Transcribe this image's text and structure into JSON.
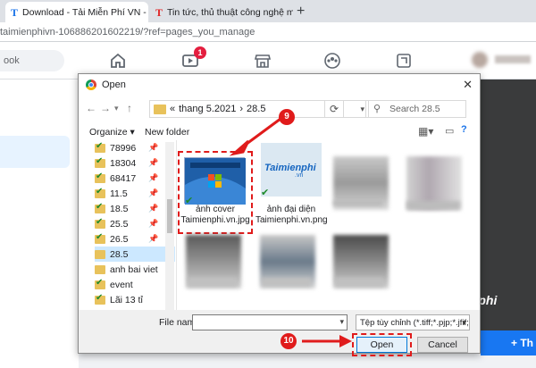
{
  "browser": {
    "tabs": [
      {
        "label": "Download - Tải Miễn Phí VN - Ph",
        "favicon": "T",
        "active": true
      },
      {
        "label": "Tin tức, thủ thuật công nghệ mới",
        "favicon": "T",
        "active": false
      }
    ],
    "close_glyph": "×",
    "new_tab_glyph": "+",
    "url": "taimienphivn-106886201602219/?ref=pages_you_manage"
  },
  "facebook": {
    "search_text": "ook",
    "notification_count": "1",
    "right_button_label": "+ Th",
    "icons": [
      "home-icon",
      "video-icon",
      "marketplace-icon",
      "groups-icon",
      "gaming-icon"
    ]
  },
  "dialog": {
    "title": "Open",
    "close_glyph": "✕",
    "path": {
      "prefix": "«",
      "parts": [
        "thang 5.2021",
        "28.5"
      ],
      "separator": "›"
    },
    "search_placeholder": "Search 28.5",
    "toolbar": {
      "organize": "Organize ▾",
      "new_folder": "New folder"
    },
    "nav_items": [
      {
        "label": "78996",
        "pinned": true,
        "selected": false
      },
      {
        "label": "18304",
        "pinned": true,
        "selected": false
      },
      {
        "label": "68417",
        "pinned": true,
        "selected": false
      },
      {
        "label": "11.5",
        "pinned": true,
        "selected": false
      },
      {
        "label": "18.5",
        "pinned": true,
        "selected": false
      },
      {
        "label": "25.5",
        "pinned": true,
        "selected": false
      },
      {
        "label": "26.5",
        "pinned": true,
        "selected": false
      },
      {
        "label": "28.5",
        "pinned": false,
        "selected": true
      },
      {
        "label": "anh bai viet",
        "pinned": false,
        "selected": false
      },
      {
        "label": "event",
        "pinned": false,
        "selected": false
      },
      {
        "label": "Lãi 13 tỉ",
        "pinned": false,
        "selected": false
      }
    ],
    "files": [
      {
        "caption": "ảnh cover Taimienphi.vn.jpg",
        "selected": true
      },
      {
        "caption": "ảnh đại diện Taimienphi.vn.png",
        "selected": false
      }
    ],
    "file_name_label": "File name:",
    "file_name_value": "",
    "file_type": "Tệp tùy chỉnh (*.tiff;*.pjp;*.jfif;*",
    "open_label": "Open",
    "cancel_label": "Cancel",
    "thumb_brand": "Taimienphi",
    "thumb_brand_sub": ".vn"
  },
  "annotations": {
    "step_a": "9",
    "step_b": "10"
  },
  "watermark": "Taimienphi",
  "colors": {
    "accent": "#1877f2",
    "highlight": "#e01b1b",
    "selection": "#cce8ff"
  }
}
